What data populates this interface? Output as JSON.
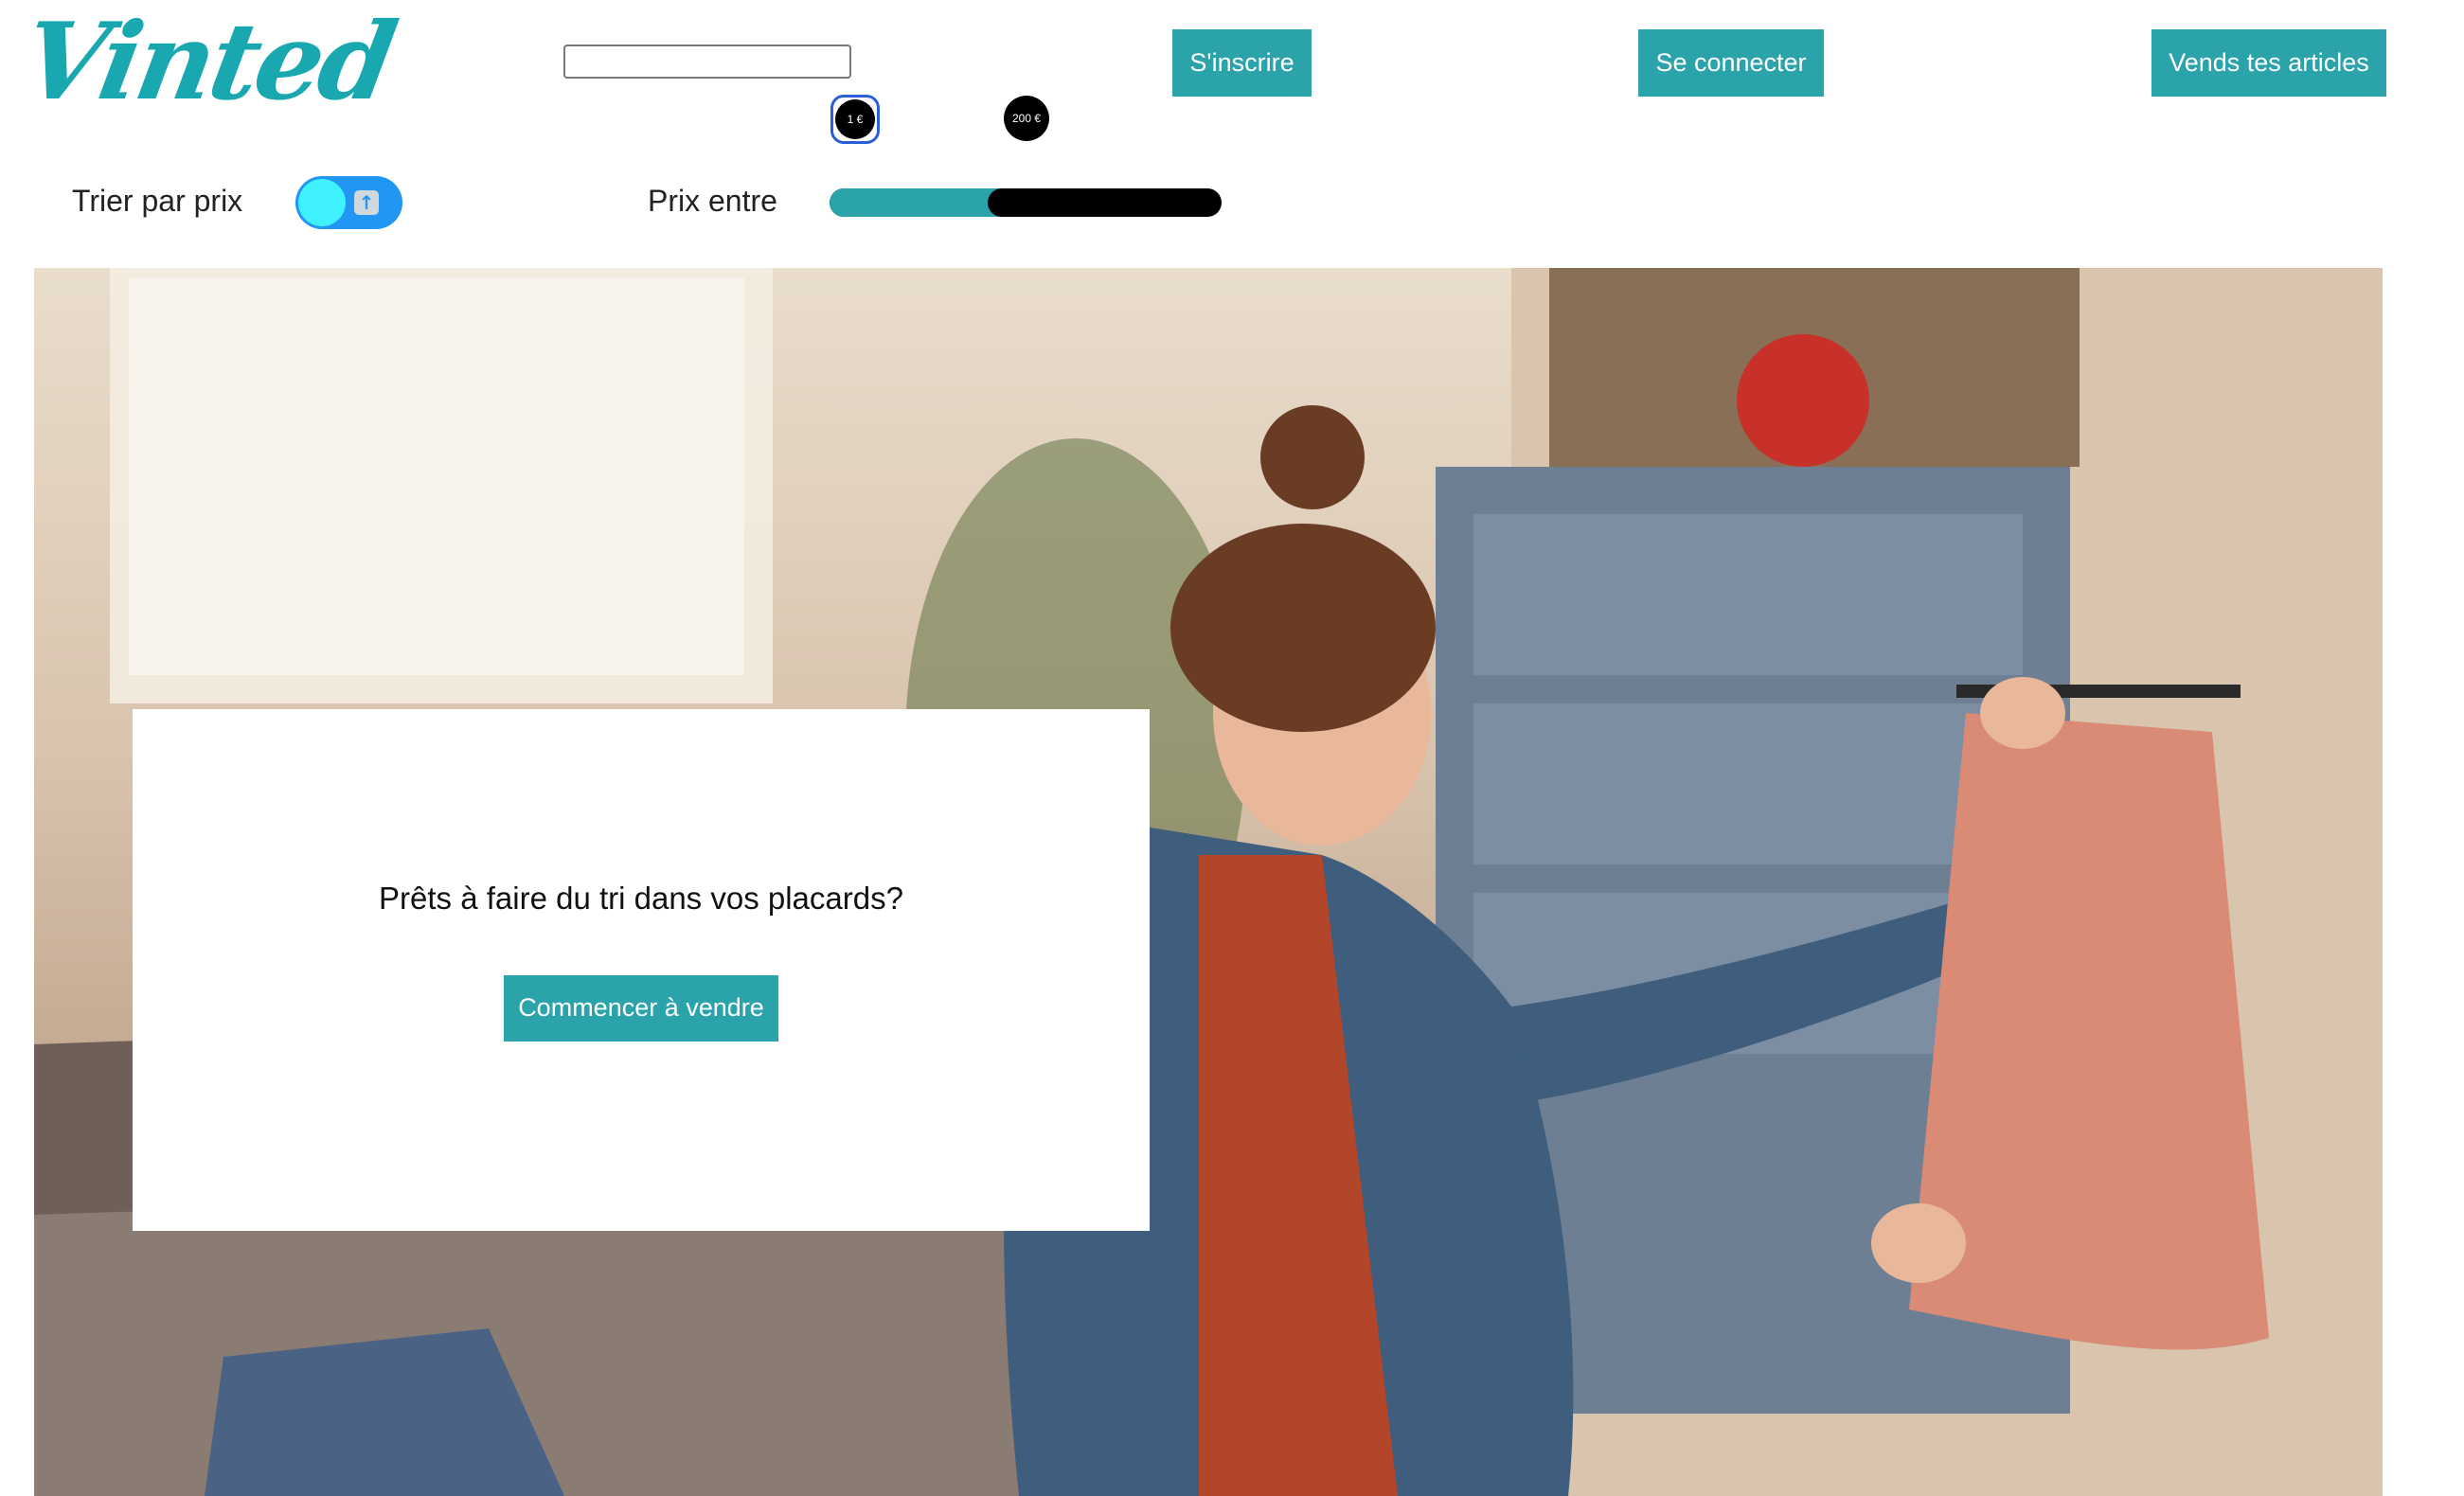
{
  "brand": {
    "logo_text": "Vinted",
    "accent_color": "#2aa3ab"
  },
  "header": {
    "search": {
      "value": "",
      "placeholder": ""
    },
    "signup_label": "S'inscrire",
    "login_label": "Se connecter",
    "sell_label": "Vends tes articles"
  },
  "filters": {
    "sort_label": "Trier par prix",
    "sort_toggle_on": true,
    "sort_icon": "arrow-up-icon",
    "price_label": "Prix entre",
    "price_min_label": "1 €",
    "price_max_label": "200 €",
    "price_min": 1,
    "price_max": 200,
    "range_fill_fraction": 0.44
  },
  "hero": {
    "title": "Prêts à faire du tri dans vos placards?",
    "cta_label": "Commencer à vendre"
  }
}
